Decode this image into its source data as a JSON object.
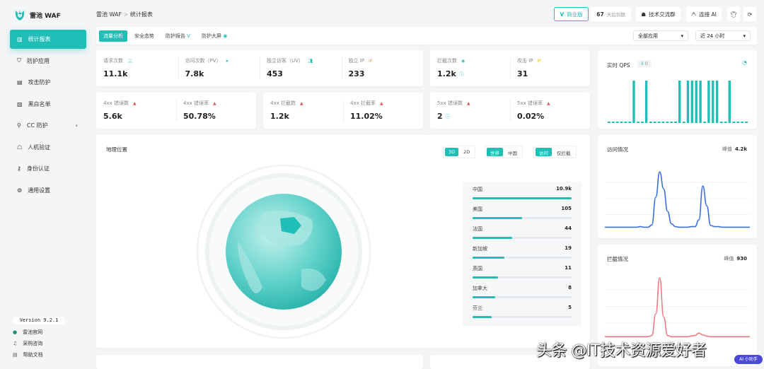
{
  "app": {
    "name": "雷池 WAF",
    "version": "Version 9.2.1"
  },
  "sidebar": {
    "items": [
      {
        "label": "统计报表",
        "icon": "bar-chart-icon",
        "active": true
      },
      {
        "label": "防护应用",
        "icon": "shield-icon"
      },
      {
        "label": "攻击防护",
        "icon": "document-shield-icon"
      },
      {
        "label": "黑白名单",
        "icon": "list-box-icon"
      },
      {
        "label": "CC 防护",
        "icon": "pin-icon",
        "chevron": "›"
      },
      {
        "label": "人机验证",
        "icon": "robot-icon"
      },
      {
        "label": "身份认证",
        "icon": "key-icon"
      },
      {
        "label": "通用设置",
        "icon": "gear-icon"
      }
    ],
    "footer": [
      {
        "label": "雷池官网",
        "icon": "shield-dot-icon"
      },
      {
        "label": "采购咨询",
        "icon": "headset-icon"
      },
      {
        "label": "帮助文档",
        "icon": "doc-icon"
      }
    ]
  },
  "header": {
    "breadcrumb": [
      "雷池 WAF",
      "统计报表"
    ],
    "sep": ">",
    "edition": "商业版",
    "days": "67",
    "days_label": "天后到期",
    "community": "技术交流群",
    "ai": "连接 AI"
  },
  "tabs": [
    "流量分析",
    "安全态势",
    "防护报告",
    "防护大屏"
  ],
  "filters": {
    "app": "全部应用",
    "range": "近 24 小时"
  },
  "stats": [
    {
      "label": "请求次数",
      "value": "11.1k"
    },
    {
      "label": "访问次数（PV）",
      "value": "7.8k"
    },
    {
      "label": "独立访客（UV）",
      "value": "453"
    },
    {
      "label": "独立 IP",
      "value": "233"
    },
    {
      "label": "拦截次数",
      "value": "1.2k"
    },
    {
      "label": "攻击 IP",
      "value": "31"
    },
    {
      "label": "4xx 错误数",
      "value": "5.6k"
    },
    {
      "label": "4xx 错误率",
      "value": "50.78%"
    },
    {
      "label": "4xx 拦截数",
      "value": "1.2k"
    },
    {
      "label": "4xx 拦截率",
      "value": "11.02%"
    },
    {
      "label": "5xx 错误数",
      "value": "2"
    },
    {
      "label": "5xx 错误率",
      "value": "0.02%"
    }
  ],
  "geo": {
    "title": "地理位置",
    "toggles": [
      [
        "3D",
        "2D"
      ],
      [
        "世界",
        "中国"
      ],
      [
        "访问",
        "仅拦截"
      ]
    ],
    "countries": [
      {
        "name": "中国",
        "value": "10.9k",
        "pct": 100
      },
      {
        "name": "美国",
        "value": "105",
        "pct": 50
      },
      {
        "name": "法国",
        "value": "44",
        "pct": 40
      },
      {
        "name": "新加坡",
        "value": "19",
        "pct": 32
      },
      {
        "name": "英国",
        "value": "11",
        "pct": 26
      },
      {
        "name": "加拿大",
        "value": "8",
        "pct": 23
      },
      {
        "name": "芬兰",
        "value": "5",
        "pct": 19
      }
    ]
  },
  "qps": {
    "title": "实时 QPS",
    "badge": "0",
    "bars": [
      0,
      0,
      0,
      0,
      0,
      0,
      1,
      0,
      0,
      1,
      0,
      0,
      0,
      0,
      0,
      0,
      0,
      1,
      0,
      1,
      1,
      1,
      1,
      0,
      1,
      1,
      1,
      0,
      0,
      1,
      0,
      0,
      0,
      0
    ]
  },
  "visits": {
    "title": "访问情况",
    "peak_label": "峰值",
    "peak": "4.2k",
    "color": "#3a6fe0",
    "series": [
      2,
      2,
      2,
      2,
      2,
      2,
      2,
      2,
      2,
      3,
      2,
      2,
      6,
      55,
      100,
      70,
      30,
      8,
      3,
      2,
      2,
      2,
      3,
      3,
      15,
      75,
      40,
      5,
      3,
      3,
      2,
      2,
      2,
      2,
      2,
      2,
      2,
      2
    ]
  },
  "blocks": {
    "title": "拦截情况",
    "peak_label": "峰值",
    "peak": "930",
    "color": "#f07a80",
    "series": [
      2,
      2,
      2,
      2,
      2,
      2,
      2,
      2,
      2,
      2,
      2,
      2,
      4,
      40,
      100,
      35,
      4,
      2,
      2,
      2,
      2,
      2,
      3,
      4,
      8,
      5,
      3,
      2,
      2,
      2,
      2,
      2,
      2,
      2,
      2,
      2,
      2,
      2
    ]
  },
  "watermark": "头条 @IT技术资源爱好者",
  "assistant": "AI 小助手"
}
